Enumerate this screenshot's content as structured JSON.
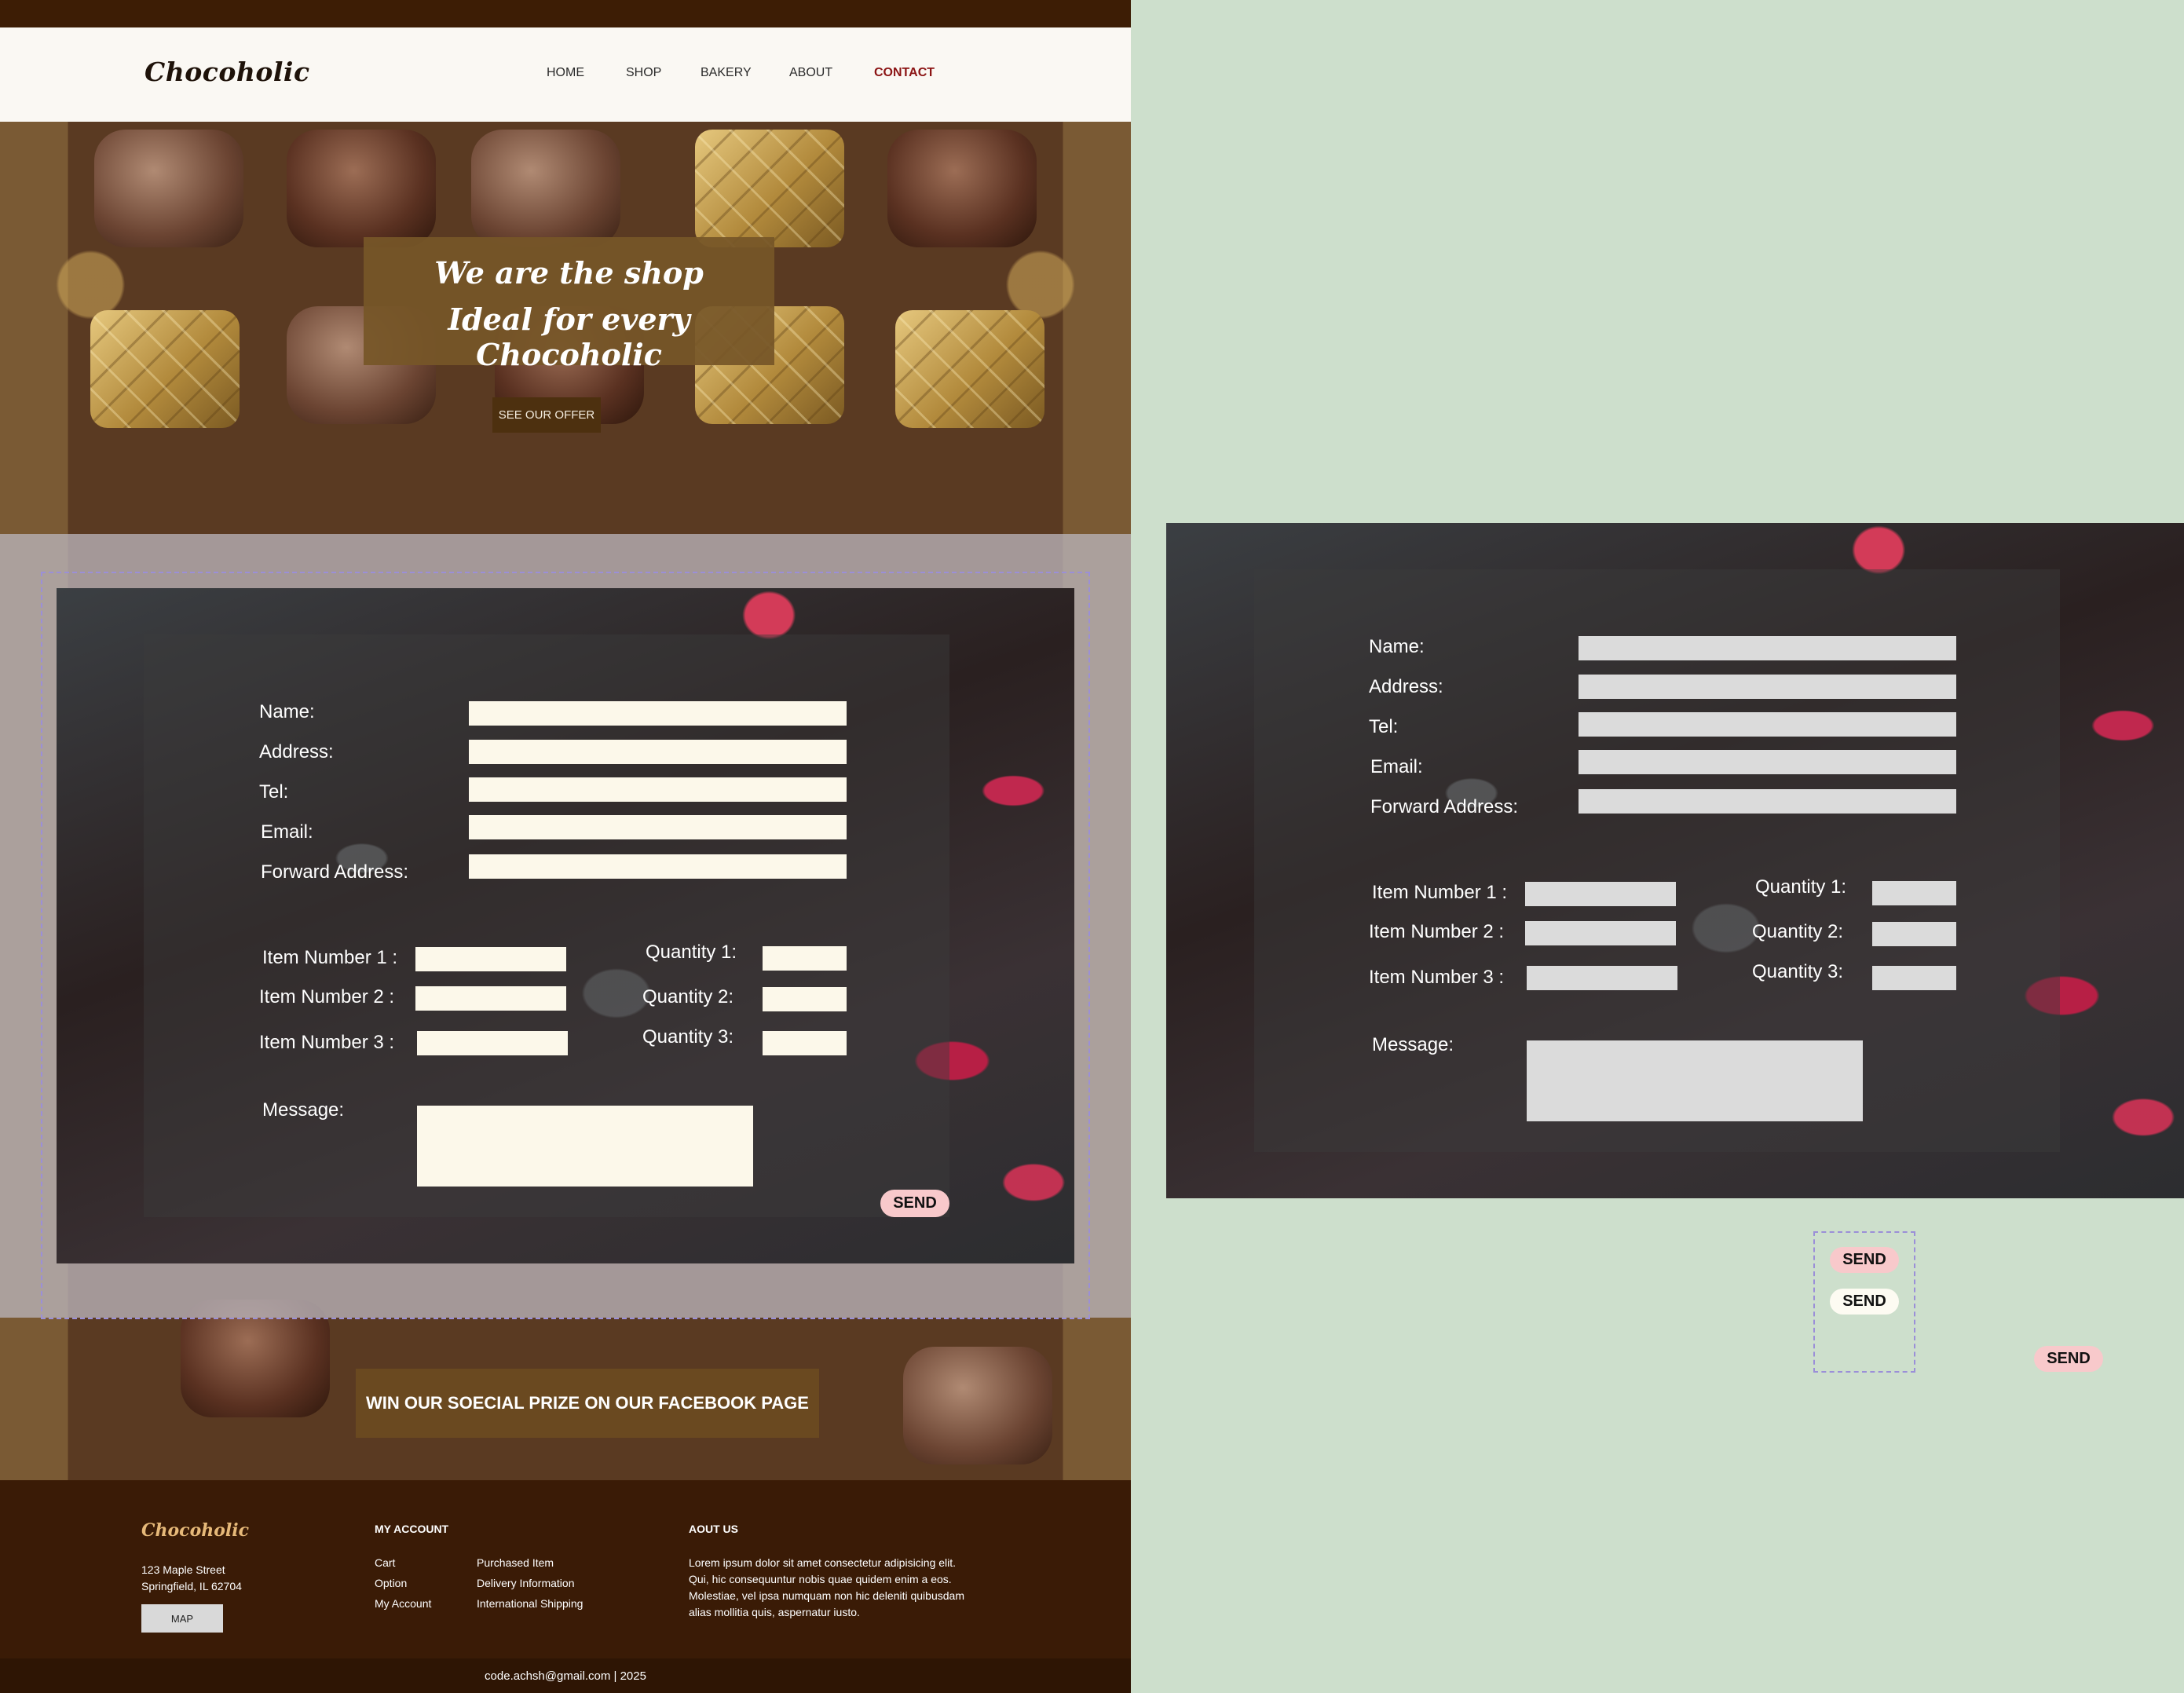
{
  "header": {
    "logo": "Chocoholic",
    "nav": [
      "HOME",
      "SHOP",
      "BAKERY",
      "ABOUT",
      "CONTACT"
    ],
    "active_nav": "CONTACT"
  },
  "hero": {
    "title_line1": "We are the shop",
    "title_line2": "Ideal for every Chocoholic",
    "offer_button": "SEE OUR OFFER"
  },
  "form": {
    "labels": {
      "name": "Name:",
      "address": "Address:",
      "tel": "Tel:",
      "email": "Email:",
      "forward_address": "Forward Address:",
      "item1": "Item Number 1 :",
      "item2": "Item Number 2 :",
      "item3": "Item Number 3 :",
      "qty1": "Quantity 1:",
      "qty2": "Quantity 2:",
      "qty3": "Quantity 3:",
      "message": "Message:"
    },
    "send": "SEND"
  },
  "facebook_banner": "WIN OUR SOECIAL PRIZE ON OUR FACEBOOK PAGE",
  "footer": {
    "logo": "Chocoholic",
    "address_line1": "123 Maple Street",
    "address_line2": "Springfield, IL 62704",
    "map_button": "MAP",
    "my_account_heading": "MY ACCOUNT",
    "col1": [
      "Cart",
      "Option",
      "My Account"
    ],
    "col2": [
      "Purchased Item",
      "Delivery Information",
      "International Shipping"
    ],
    "about_heading": "AOUT US",
    "about_lines": [
      "Lorem ipsum dolor sit amet consectetur adipisicing elit.",
      "Qui, hic consequuntur nobis quae quidem enim a eos.",
      "Molestiae, vel ipsa numquam non hic deleniti quibusdam",
      "alias mollitia quis, aspernatur iusto."
    ],
    "copyright": "code.achsh@gmail.com | 2025"
  },
  "variants": {
    "send_pink": "SEND",
    "send_white": "SEND",
    "send_floating": "SEND"
  },
  "colors": {
    "canvas_bg": "#cddfcc",
    "header_bg": "#faf8f3",
    "brand_dark": "#3a1b06",
    "active_link": "#8b1414",
    "field_cream": "#fcf8ea",
    "field_gray": "#dbdbdb",
    "send_pink": "#f8c9cb",
    "title_box": "#765628"
  }
}
